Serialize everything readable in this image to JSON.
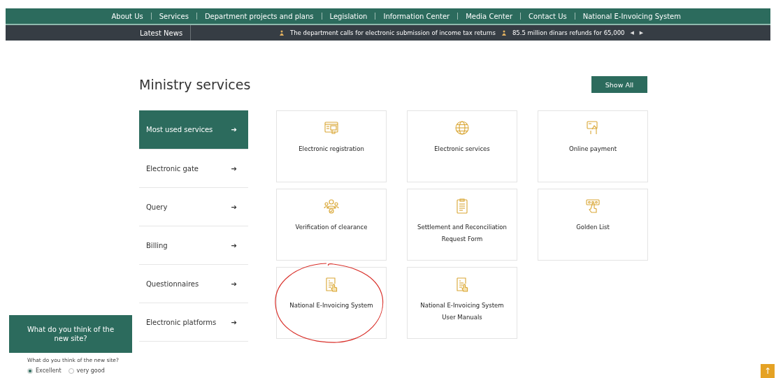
{
  "nav": {
    "items": [
      "About Us",
      "Services",
      "Department projects and plans",
      "Legislation",
      "Information Center",
      "Media Center",
      "Contact Us",
      "National E-Invoicing System"
    ]
  },
  "news": {
    "label": "Latest News",
    "items": [
      "The department calls for electronic submission of income tax returns",
      "85.5 million dinars refunds for 65,000"
    ],
    "prev": "◀",
    "next": "▶"
  },
  "section": {
    "title": "Ministry services",
    "show_all": "Show All"
  },
  "sidebar": {
    "items": [
      {
        "label": "Most used services",
        "arrow": "➔",
        "selected": true
      },
      {
        "label": "Electronic gate",
        "arrow": "➔",
        "selected": false
      },
      {
        "label": "Query",
        "arrow": "➔",
        "selected": false
      },
      {
        "label": "Billing",
        "arrow": "➔",
        "selected": false
      },
      {
        "label": "Questionnaires",
        "arrow": "➔",
        "selected": false
      },
      {
        "label": "Electronic platforms",
        "arrow": "➔",
        "selected": false
      }
    ]
  },
  "cards": [
    {
      "label": "Electronic registration",
      "kind": "browser",
      "circled": false
    },
    {
      "label": "Electronic services",
      "kind": "globe",
      "circled": false
    },
    {
      "label": "Online payment",
      "kind": "card",
      "circled": false
    },
    {
      "label": "Verification of clearance",
      "kind": "people",
      "circled": false
    },
    {
      "label": "Settlement and Reconciliation Request Form",
      "kind": "clipboard",
      "circled": false
    },
    {
      "label": "Golden List",
      "kind": "stars",
      "circled": false
    },
    {
      "label": "National E-Invoicing System",
      "kind": "invoice",
      "circled": true
    },
    {
      "label": "National E-Invoicing System User Manuals",
      "kind": "invoice",
      "circled": false
    }
  ],
  "feedback": {
    "banner": "What do you think of the new site?",
    "question": "What do you think of the new site?",
    "options": [
      {
        "label": "Excellent",
        "selected": true
      },
      {
        "label": "very good",
        "selected": false
      }
    ]
  },
  "back_to_top": "↑"
}
